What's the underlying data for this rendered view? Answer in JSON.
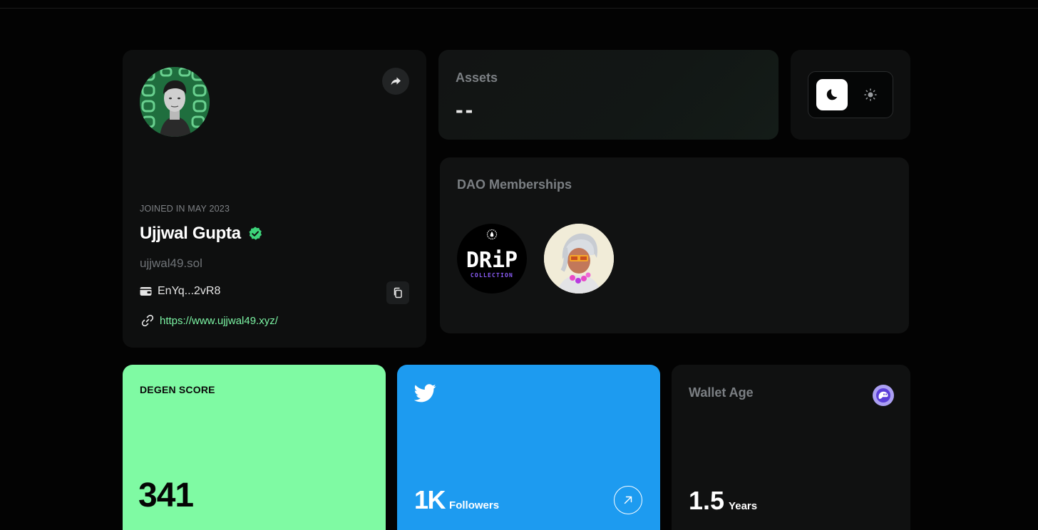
{
  "profile": {
    "joined": "JOINED IN MAY 2023",
    "name": "Ujjwal Gupta",
    "handle": "ujjwal49.sol",
    "wallet": "EnYq...2vR8",
    "website": "https://www.ujjwal49.xyz/",
    "avatar_icon": "user-avatar",
    "verified_color": "#3dd37a"
  },
  "assets": {
    "title": "Assets",
    "value": "--"
  },
  "theme_toggle": {
    "options": [
      "moon-icon",
      "sun-icon"
    ],
    "selected": "dark"
  },
  "dao": {
    "title": "DAO Memberships",
    "items": [
      {
        "label_main": "DRiP",
        "label_sub": "COLLECTION"
      },
      {
        "icon": "nft-character-avatar"
      }
    ]
  },
  "degen": {
    "label": "DEGEN SCORE",
    "value": "341",
    "color": "#7ffaa3"
  },
  "twitter": {
    "value": "1K",
    "unit": "Followers",
    "color": "#1d9bf0"
  },
  "wallet_age": {
    "title": "Wallet Age",
    "value": "1.5",
    "unit": "Years",
    "icon": "phantom-icon",
    "icon_color": "#ab9ff2"
  }
}
